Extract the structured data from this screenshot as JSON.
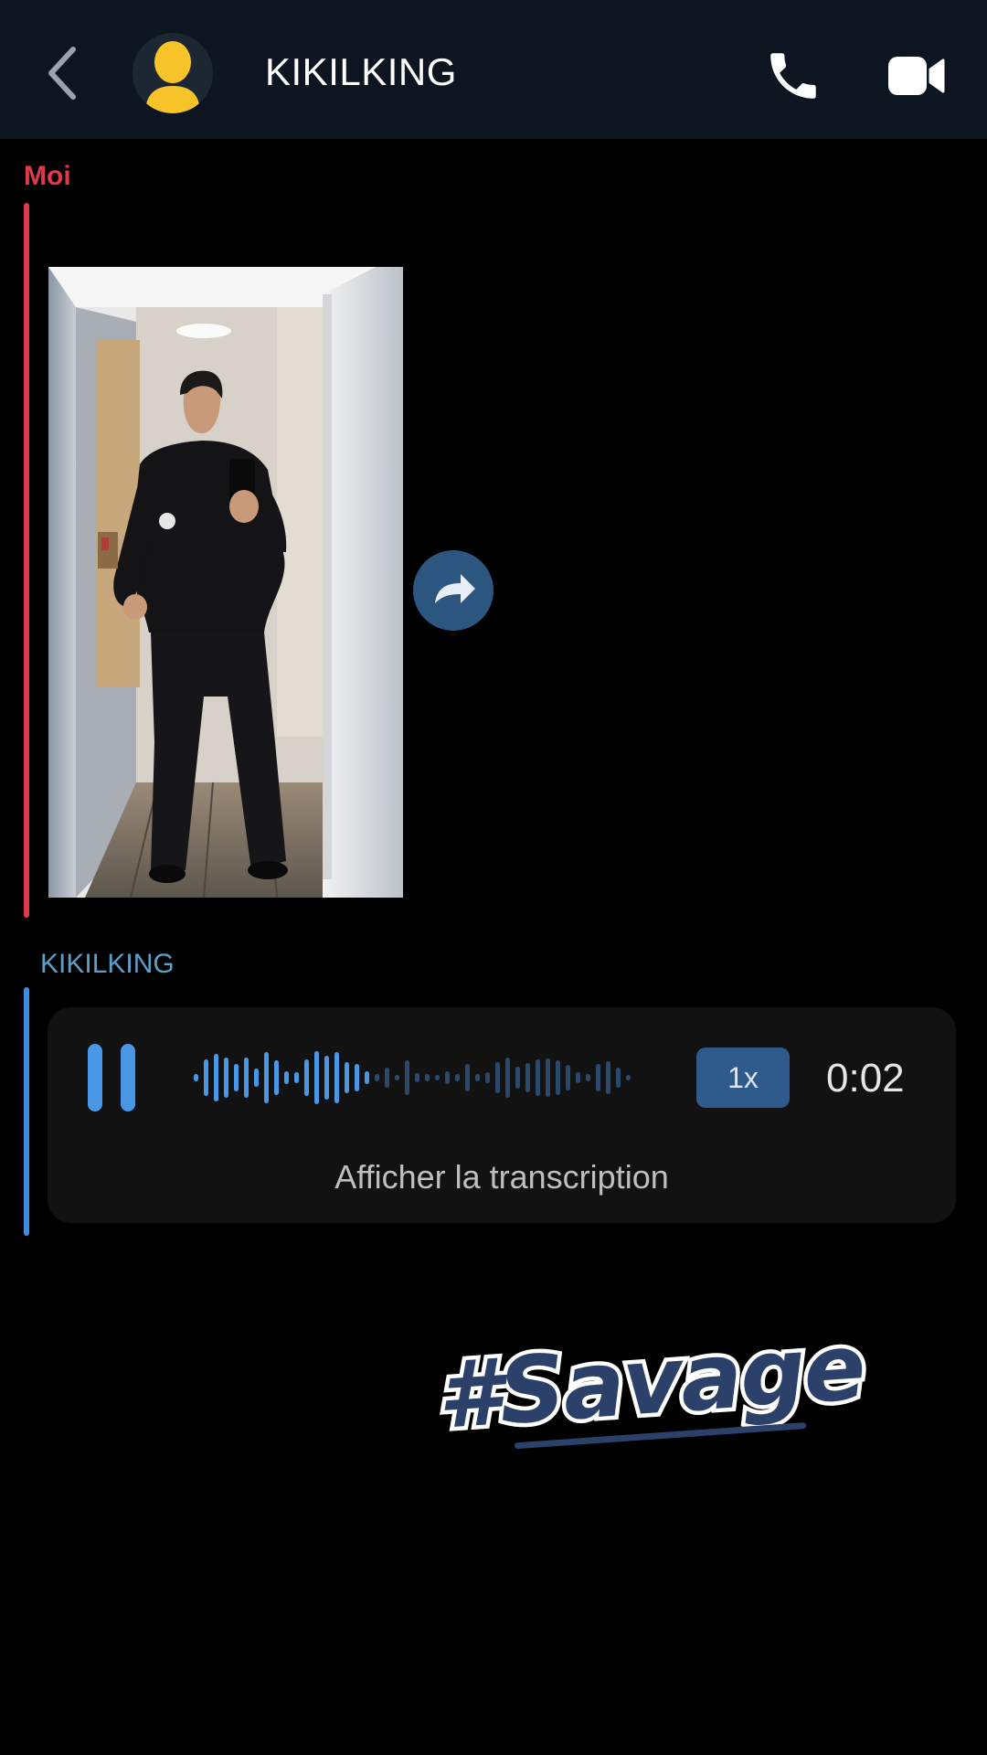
{
  "header": {
    "contact_name": "KIKILKING",
    "back_icon": "chevron-left-icon",
    "avatar_icon": "user-silhouette-icon",
    "call_icon": "phone-icon",
    "video_icon": "video-camera-icon"
  },
  "messages": [
    {
      "sender": "Moi",
      "type": "photo",
      "forward_icon": "forward-arrow-icon"
    },
    {
      "sender": "KIKILKING",
      "type": "voice",
      "play_state_icon": "pause-icon",
      "playback_speed": "1x",
      "duration": "0:02",
      "playback_progress": 0.4,
      "transcription_label": "Afficher la transcription"
    }
  ],
  "sticker": {
    "text": "#Savage"
  },
  "colors": {
    "header_bg": "#0d1620",
    "me_accent": "#e0394b",
    "them_accent": "#5aa0c8",
    "them_bar": "#3f8be0",
    "avatar_yellow": "#f6c428",
    "voice_played": "#4a97e6",
    "voice_unplayed": "#2b4a6b",
    "speed_bg": "#2e5b8c",
    "forward_bg": "#2c5580",
    "sticker_underline": "#2c4169"
  }
}
